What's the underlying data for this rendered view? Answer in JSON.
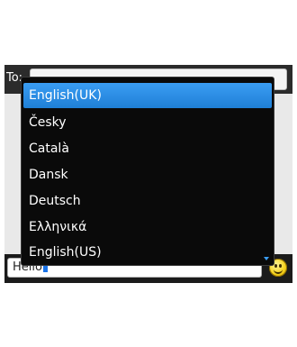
{
  "header": {
    "to_label": "To:"
  },
  "compose": {
    "text": "Hello"
  },
  "language_menu": {
    "items": [
      {
        "label": "English(UK)",
        "selected": true
      },
      {
        "label": "Česky",
        "selected": false
      },
      {
        "label": "Català",
        "selected": false
      },
      {
        "label": "Dansk",
        "selected": false
      },
      {
        "label": "Deutsch",
        "selected": false
      },
      {
        "label": "Ελληνικά",
        "selected": false
      },
      {
        "label": "English(US)",
        "selected": false
      }
    ]
  },
  "icons": {
    "emoticon": "smiley-icon",
    "scroll_more": "chevron-down-icon"
  },
  "colors": {
    "selection": "#2f8ee8",
    "menu_bg": "#0a0a0a"
  }
}
